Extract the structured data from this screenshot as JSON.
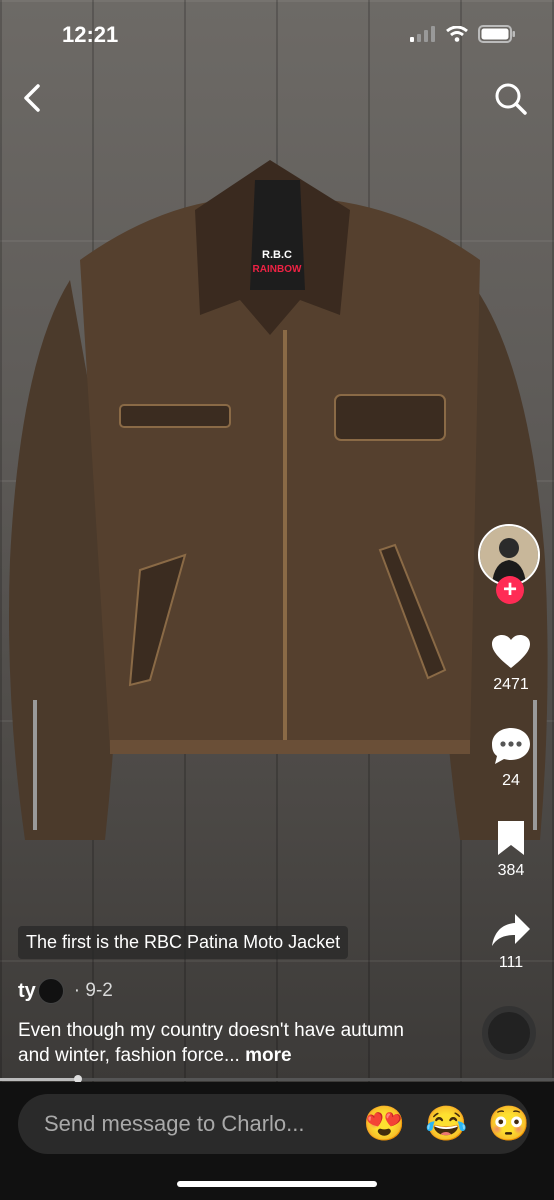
{
  "status": {
    "time": "12:21"
  },
  "actions": {
    "likes": "2471",
    "comments": "24",
    "saves": "384",
    "shares": "111"
  },
  "post": {
    "caption_tag": "The first is the RBC Patina Moto Jacket",
    "author": "ty",
    "date": "· 9-2",
    "description": "Even though my country doesn't have autumn and winter, fashion force...",
    "more": "more"
  },
  "message": {
    "placeholder": "Send message to Charlo...",
    "emojis": [
      "😍",
      "😂",
      "😳"
    ]
  },
  "label": {
    "line1": "R.B.C",
    "line2": "RAINBOW"
  },
  "progress": 0.14
}
